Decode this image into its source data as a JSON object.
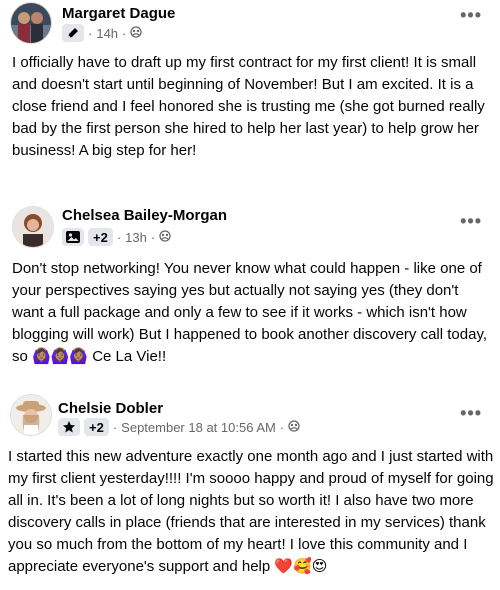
{
  "posts": [
    {
      "author": "Margaret Dague",
      "time": "14h",
      "badge": "pen-icon",
      "visibility": "group-icon",
      "text": "I officially have to draft up my first contract for my first client!  It is small and doesn't start until beginning of November!  But I am excited.  It is a close friend and I feel honored she is trusting me (she got burned really bad by the first person she hired to help her last year)  to help grow her business!  A big step for her!"
    },
    {
      "author": "Chelsea Bailey-Morgan",
      "badge_count": "+2",
      "time": "13h",
      "badge": "image-badge-icon",
      "visibility": "group-icon",
      "text": "Don't stop networking! You never know what could happen - like one of your perspectives saying yes but actually not saying yes (they don't want a full package and only a few to see if it works - which isn't how blogging will work) But I happened to book another discovery call today, so 🙆🏽‍♀️🙆🏽‍♀️🙆🏽‍♀️  Ce La Vie!!"
    },
    {
      "author": "Chelsie Dobler",
      "badge_count": "+2",
      "time": "September 18 at 10:56 AM",
      "badge": "star-icon",
      "visibility": "group-icon",
      "text": "I started this new adventure exactly one month ago and I just started with my first client yesterday!!!! I'm soooo happy and proud of myself for going all in. It's been a lot of long nights but so worth it! I also have two more discovery calls in place (friends that are interested in my services) thank you so much from the bottom of my heart! I love this community and I appreciate everyone's support and help ❤️🥰😍"
    }
  ],
  "more_label": "•••",
  "separator": "·"
}
